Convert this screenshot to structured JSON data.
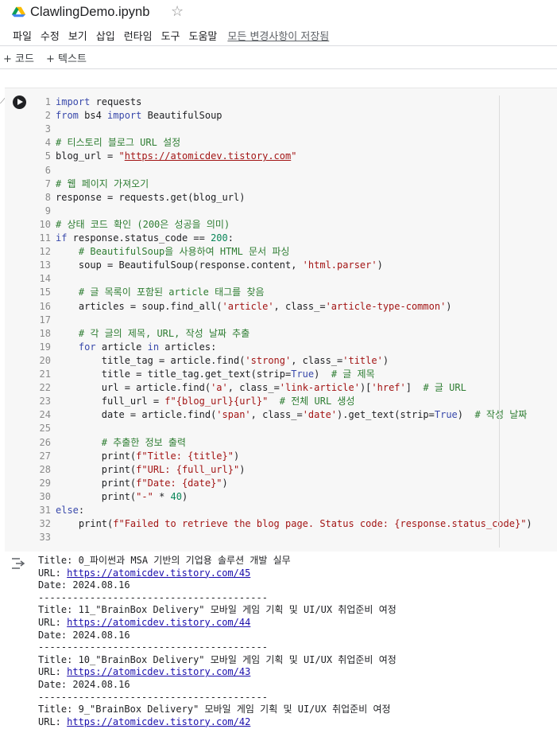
{
  "app": {
    "title": "ClawlingDemo.ipynb",
    "menu": [
      "파일",
      "수정",
      "보기",
      "삽입",
      "런타임",
      "도구",
      "도움말"
    ],
    "saved_status": "모든 변경사항이 저장됨",
    "toolbar": {
      "add_code": "+ 코드",
      "add_text": "+ 텍스트"
    }
  },
  "cell": {
    "lines": [
      {
        "n": "1",
        "segs": [
          {
            "t": "import",
            "c": "kw"
          },
          {
            "t": " requests",
            "c": ""
          }
        ]
      },
      {
        "n": "2",
        "segs": [
          {
            "t": "from",
            "c": "kw"
          },
          {
            "t": " bs4 ",
            "c": ""
          },
          {
            "t": "import",
            "c": "kw"
          },
          {
            "t": " BeautifulSoup",
            "c": ""
          }
        ]
      },
      {
        "n": "3",
        "segs": []
      },
      {
        "n": "4",
        "segs": [
          {
            "t": "# 티스토리 블로그 URL 설정",
            "c": "cm"
          }
        ]
      },
      {
        "n": "5",
        "segs": [
          {
            "t": "blog_url = ",
            "c": ""
          },
          {
            "t": "\"",
            "c": "str"
          },
          {
            "t": "https://atomicdev.tistory.com",
            "c": "url"
          },
          {
            "t": "\"",
            "c": "str"
          }
        ]
      },
      {
        "n": "6",
        "segs": []
      },
      {
        "n": "7",
        "segs": [
          {
            "t": "# 웹 페이지 가져오기",
            "c": "cm"
          }
        ]
      },
      {
        "n": "8",
        "segs": [
          {
            "t": "response = requests.get(blog_url)",
            "c": ""
          }
        ]
      },
      {
        "n": "9",
        "segs": []
      },
      {
        "n": "10",
        "segs": [
          {
            "t": "# 상태 코드 확인 (200은 성공을 의미)",
            "c": "cm"
          }
        ]
      },
      {
        "n": "11",
        "segs": [
          {
            "t": "if",
            "c": "kw"
          },
          {
            "t": " response.status_code == ",
            "c": ""
          },
          {
            "t": "200",
            "c": "num"
          },
          {
            "t": ":",
            "c": ""
          }
        ]
      },
      {
        "n": "12",
        "segs": [
          {
            "t": "    # BeautifulSoup을 사용하여 HTML 문서 파싱",
            "c": "cm"
          }
        ]
      },
      {
        "n": "13",
        "segs": [
          {
            "t": "    soup = BeautifulSoup(response.content, ",
            "c": ""
          },
          {
            "t": "'html.parser'",
            "c": "str"
          },
          {
            "t": ")",
            "c": ""
          }
        ]
      },
      {
        "n": "14",
        "segs": []
      },
      {
        "n": "15",
        "segs": [
          {
            "t": "    # 글 목록이 포함된 article 태그를 찾음",
            "c": "cm"
          }
        ]
      },
      {
        "n": "16",
        "segs": [
          {
            "t": "    articles = soup.find_all(",
            "c": ""
          },
          {
            "t": "'article'",
            "c": "str"
          },
          {
            "t": ", class_=",
            "c": ""
          },
          {
            "t": "'article-type-common'",
            "c": "str"
          },
          {
            "t": ")",
            "c": ""
          }
        ]
      },
      {
        "n": "17",
        "segs": []
      },
      {
        "n": "18",
        "segs": [
          {
            "t": "    # 각 글의 제목, URL, 작성 날짜 추출",
            "c": "cm"
          }
        ]
      },
      {
        "n": "19",
        "segs": [
          {
            "t": "    ",
            "c": ""
          },
          {
            "t": "for",
            "c": "kw"
          },
          {
            "t": " article ",
            "c": ""
          },
          {
            "t": "in",
            "c": "kw"
          },
          {
            "t": " articles:",
            "c": ""
          }
        ]
      },
      {
        "n": "20",
        "segs": [
          {
            "t": "        title_tag = article.find(",
            "c": ""
          },
          {
            "t": "'strong'",
            "c": "str"
          },
          {
            "t": ", class_=",
            "c": ""
          },
          {
            "t": "'title'",
            "c": "str"
          },
          {
            "t": ")",
            "c": ""
          }
        ]
      },
      {
        "n": "21",
        "segs": [
          {
            "t": "        title = title_tag.get_text(strip=",
            "c": ""
          },
          {
            "t": "True",
            "c": "kw"
          },
          {
            "t": ")  ",
            "c": ""
          },
          {
            "t": "# 글 제목",
            "c": "cm"
          }
        ]
      },
      {
        "n": "22",
        "segs": [
          {
            "t": "        url = article.find(",
            "c": ""
          },
          {
            "t": "'a'",
            "c": "str"
          },
          {
            "t": ", class_=",
            "c": ""
          },
          {
            "t": "'link-article'",
            "c": "str"
          },
          {
            "t": ")[",
            "c": ""
          },
          {
            "t": "'href'",
            "c": "str"
          },
          {
            "t": "]  ",
            "c": ""
          },
          {
            "t": "# 글 URL",
            "c": "cm"
          }
        ]
      },
      {
        "n": "23",
        "segs": [
          {
            "t": "        full_url = ",
            "c": ""
          },
          {
            "t": "f\"{blog_url}{url}\"",
            "c": "str"
          },
          {
            "t": "  ",
            "c": ""
          },
          {
            "t": "# 전체 URL 생성",
            "c": "cm"
          }
        ]
      },
      {
        "n": "24",
        "segs": [
          {
            "t": "        date = article.find(",
            "c": ""
          },
          {
            "t": "'span'",
            "c": "str"
          },
          {
            "t": ", class_=",
            "c": ""
          },
          {
            "t": "'date'",
            "c": "str"
          },
          {
            "t": ").get_text(strip=",
            "c": ""
          },
          {
            "t": "True",
            "c": "kw"
          },
          {
            "t": ")  ",
            "c": ""
          },
          {
            "t": "# 작성 날짜",
            "c": "cm"
          }
        ]
      },
      {
        "n": "25",
        "segs": []
      },
      {
        "n": "26",
        "segs": [
          {
            "t": "        # 추출한 정보 출력",
            "c": "cm"
          }
        ]
      },
      {
        "n": "27",
        "segs": [
          {
            "t": "        print(",
            "c": ""
          },
          {
            "t": "f\"Title: {title}\"",
            "c": "str"
          },
          {
            "t": ")",
            "c": ""
          }
        ]
      },
      {
        "n": "28",
        "segs": [
          {
            "t": "        print(",
            "c": ""
          },
          {
            "t": "f\"URL: {full_url}\"",
            "c": "str"
          },
          {
            "t": ")",
            "c": ""
          }
        ]
      },
      {
        "n": "29",
        "segs": [
          {
            "t": "        print(",
            "c": ""
          },
          {
            "t": "f\"Date: {date}\"",
            "c": "str"
          },
          {
            "t": ")",
            "c": ""
          }
        ]
      },
      {
        "n": "30",
        "segs": [
          {
            "t": "        print(",
            "c": ""
          },
          {
            "t": "\"-\"",
            "c": "str"
          },
          {
            "t": " * ",
            "c": ""
          },
          {
            "t": "40",
            "c": "num"
          },
          {
            "t": ")",
            "c": ""
          }
        ]
      },
      {
        "n": "31",
        "segs": [
          {
            "t": "else",
            "c": "kw"
          },
          {
            "t": ":",
            "c": ""
          }
        ]
      },
      {
        "n": "32",
        "segs": [
          {
            "t": "    print(",
            "c": ""
          },
          {
            "t": "f\"Failed to retrieve the blog page. Status code: {response.status_code}\"",
            "c": "str"
          },
          {
            "t": ")",
            "c": ""
          }
        ]
      },
      {
        "n": "33",
        "segs": []
      }
    ]
  },
  "output": {
    "lines": [
      {
        "t": "Title: 0_파이썬과 MSA 기반의 기업용 솔루션 개발 실무"
      },
      {
        "t": "URL: ",
        "link": "https://atomicdev.tistory.com/45"
      },
      {
        "t": "Date: 2024.08.16"
      },
      {
        "t": "----------------------------------------"
      },
      {
        "t": "Title: 11_\"BrainBox Delivery\" 모바일 게임 기획 및 UI/UX 취업준비 여정"
      },
      {
        "t": "URL: ",
        "link": "https://atomicdev.tistory.com/44"
      },
      {
        "t": "Date: 2024.08.16"
      },
      {
        "t": "----------------------------------------"
      },
      {
        "t": "Title: 10_\"BrainBox Delivery\" 모바일 게임 기획 및 UI/UX 취업준비 여정"
      },
      {
        "t": "URL: ",
        "link": "https://atomicdev.tistory.com/43"
      },
      {
        "t": "Date: 2024.08.16"
      },
      {
        "t": "----------------------------------------"
      },
      {
        "t": "Title: 9_\"BrainBox Delivery\" 모바일 게임 기획 및 UI/UX 취업준비 여정"
      },
      {
        "t": "URL: ",
        "link": "https://atomicdev.tistory.com/42"
      }
    ]
  }
}
